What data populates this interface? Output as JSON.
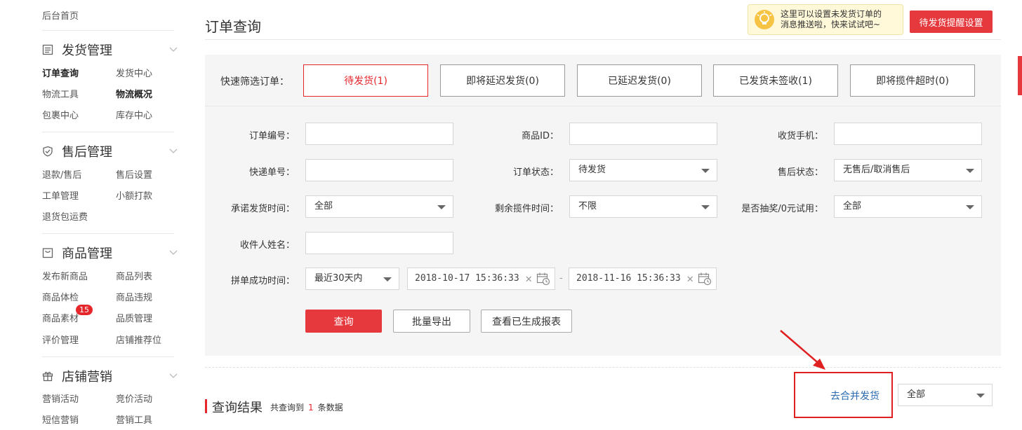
{
  "sidebar": {
    "home": "后台首页",
    "groups": [
      {
        "title": "发货管理",
        "icon": "list-doc-icon",
        "items": [
          {
            "label": "订单查询",
            "active": true
          },
          {
            "label": "发货中心"
          },
          {
            "label": "物流工具"
          },
          {
            "label": "物流概况",
            "active": true
          },
          {
            "label": "包裹中心"
          },
          {
            "label": "库存中心"
          }
        ]
      },
      {
        "title": "售后管理",
        "icon": "shield-icon",
        "items": [
          {
            "label": "退款/售后"
          },
          {
            "label": "售后设置"
          },
          {
            "label": "工单管理"
          },
          {
            "label": "小额打款"
          },
          {
            "label": "退货包运费"
          }
        ]
      },
      {
        "title": "商品管理",
        "icon": "bag-icon",
        "items": [
          {
            "label": "发布新商品"
          },
          {
            "label": "商品列表"
          },
          {
            "label": "商品体检"
          },
          {
            "label": "商品违规"
          },
          {
            "label": "商品素材",
            "badge": "15"
          },
          {
            "label": "品质管理"
          },
          {
            "label": "评价管理"
          },
          {
            "label": "店铺推荐位"
          }
        ]
      },
      {
        "title": "店铺营销",
        "icon": "gift-icon",
        "items": [
          {
            "label": "营销活动"
          },
          {
            "label": "竞价活动"
          },
          {
            "label": "短信营销"
          },
          {
            "label": "营销工具"
          }
        ]
      }
    ]
  },
  "header": {
    "title": "订单查询",
    "tip_line1": "这里可以设置未发货订单的",
    "tip_line2": "消息推送啦，快来试试吧~",
    "remind_button": "待发货提醒设置"
  },
  "quick_filter": {
    "label": "快速筛选订单：",
    "buttons": [
      {
        "label": "待发货(1)",
        "active": true
      },
      {
        "label": "即将延迟发货(0)"
      },
      {
        "label": "已延迟发货(0)"
      },
      {
        "label": "已发货未签收(1)"
      },
      {
        "label": "即将揽件超时(0)"
      }
    ]
  },
  "form": {
    "order_no": {
      "label": "订单编号：",
      "value": ""
    },
    "goods_id": {
      "label": "商品ID：",
      "value": ""
    },
    "phone": {
      "label": "收货手机：",
      "value": ""
    },
    "express_no": {
      "label": "快递单号：",
      "value": ""
    },
    "order_status": {
      "label": "订单状态：",
      "value": "待发货"
    },
    "aftersale_status": {
      "label": "售后状态：",
      "value": "无售后/取消售后"
    },
    "promise_time": {
      "label": "承诺发货时间：",
      "value": "全部"
    },
    "remain_time": {
      "label": "剩余揽件时间：",
      "value": "不限"
    },
    "lottery": {
      "label": "是否抽奖/0元试用：",
      "value": "全部"
    },
    "receiver_name": {
      "label": "收件人姓名：",
      "value": ""
    },
    "group_time": {
      "label": "拼单成功时间：",
      "range": "最近30天内",
      "start": "2018-10-17 15:36:33",
      "end": "2018-11-16 15:36:33",
      "separator": "-"
    }
  },
  "actions": {
    "query": "查询",
    "export": "批量导出",
    "view_reports": "查看已生成报表"
  },
  "results": {
    "title": "查询结果",
    "count_prefix": "共查询到",
    "count": "1",
    "count_suffix": "条数据",
    "merge_link": "去合并发货",
    "filter_value": "全部"
  },
  "colors": {
    "accent": "#e5393e",
    "link": "#2b6cb0",
    "tip_bg": "#fff8d9"
  }
}
